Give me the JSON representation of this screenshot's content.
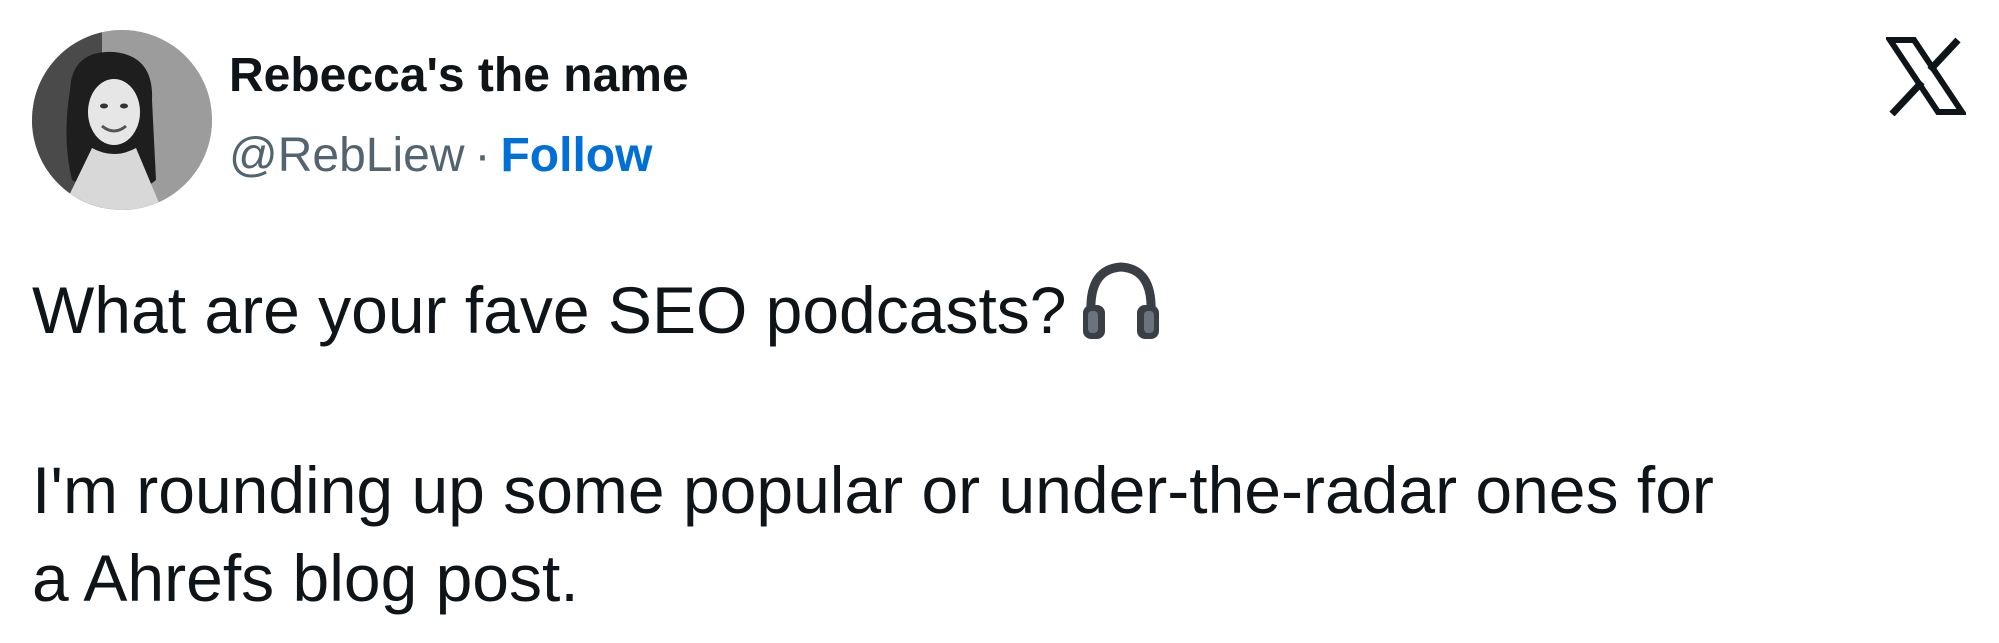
{
  "author": {
    "display_name": "Rebecca's the name",
    "handle": "@RebLiew",
    "separator": "·",
    "follow_label": "Follow"
  },
  "brand": {
    "logo_icon": "x-logo-icon"
  },
  "tweet": {
    "line1": "What are your fave SEO podcasts?",
    "emoji_icon": "headphones-icon",
    "line2": "I'm rounding up some popular or under-the-radar ones for",
    "line3": "a Ahrefs blog post."
  },
  "colors": {
    "text": "#0f1419",
    "secondary": "#536471",
    "link": "#006fd6"
  }
}
